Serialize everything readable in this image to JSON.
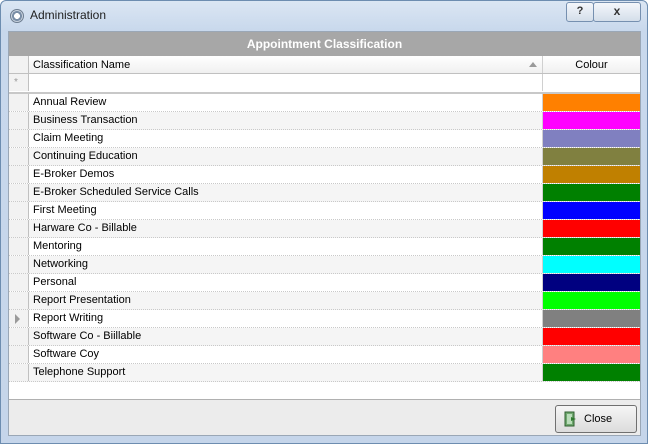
{
  "window": {
    "title": "Administration",
    "help_label": "?",
    "close_label": "x"
  },
  "grid": {
    "caption": "Appointment Classification",
    "columns": {
      "name": "Classification Name",
      "colour": "Colour"
    },
    "new_row_marker": "*",
    "rows": [
      {
        "name": "Annual Review",
        "colour": "#ff8000"
      },
      {
        "name": "Business Transaction",
        "colour": "#ff00ff"
      },
      {
        "name": "Claim Meeting",
        "colour": "#8080c0"
      },
      {
        "name": "Continuing Education",
        "colour": "#808040"
      },
      {
        "name": "E-Broker Demos",
        "colour": "#c08000"
      },
      {
        "name": "E-Broker Scheduled Service Calls",
        "colour": "#008000"
      },
      {
        "name": "First Meeting",
        "colour": "#0000ff"
      },
      {
        "name": "Harware Co - Billable",
        "colour": "#ff0000"
      },
      {
        "name": "Mentoring",
        "colour": "#008000"
      },
      {
        "name": "Networking",
        "colour": "#00ffff"
      },
      {
        "name": "Personal",
        "colour": "#000080"
      },
      {
        "name": "Report Presentation",
        "colour": "#00ff00"
      },
      {
        "name": "Report Writing",
        "colour": "#808080"
      },
      {
        "name": "Software Co - Biillable",
        "colour": "#ff0000"
      },
      {
        "name": "Software Coy",
        "colour": "#ff8080"
      },
      {
        "name": "Telephone Support",
        "colour": "#008000"
      }
    ],
    "current_row_index": 12
  },
  "footer": {
    "close_label": "Close"
  }
}
